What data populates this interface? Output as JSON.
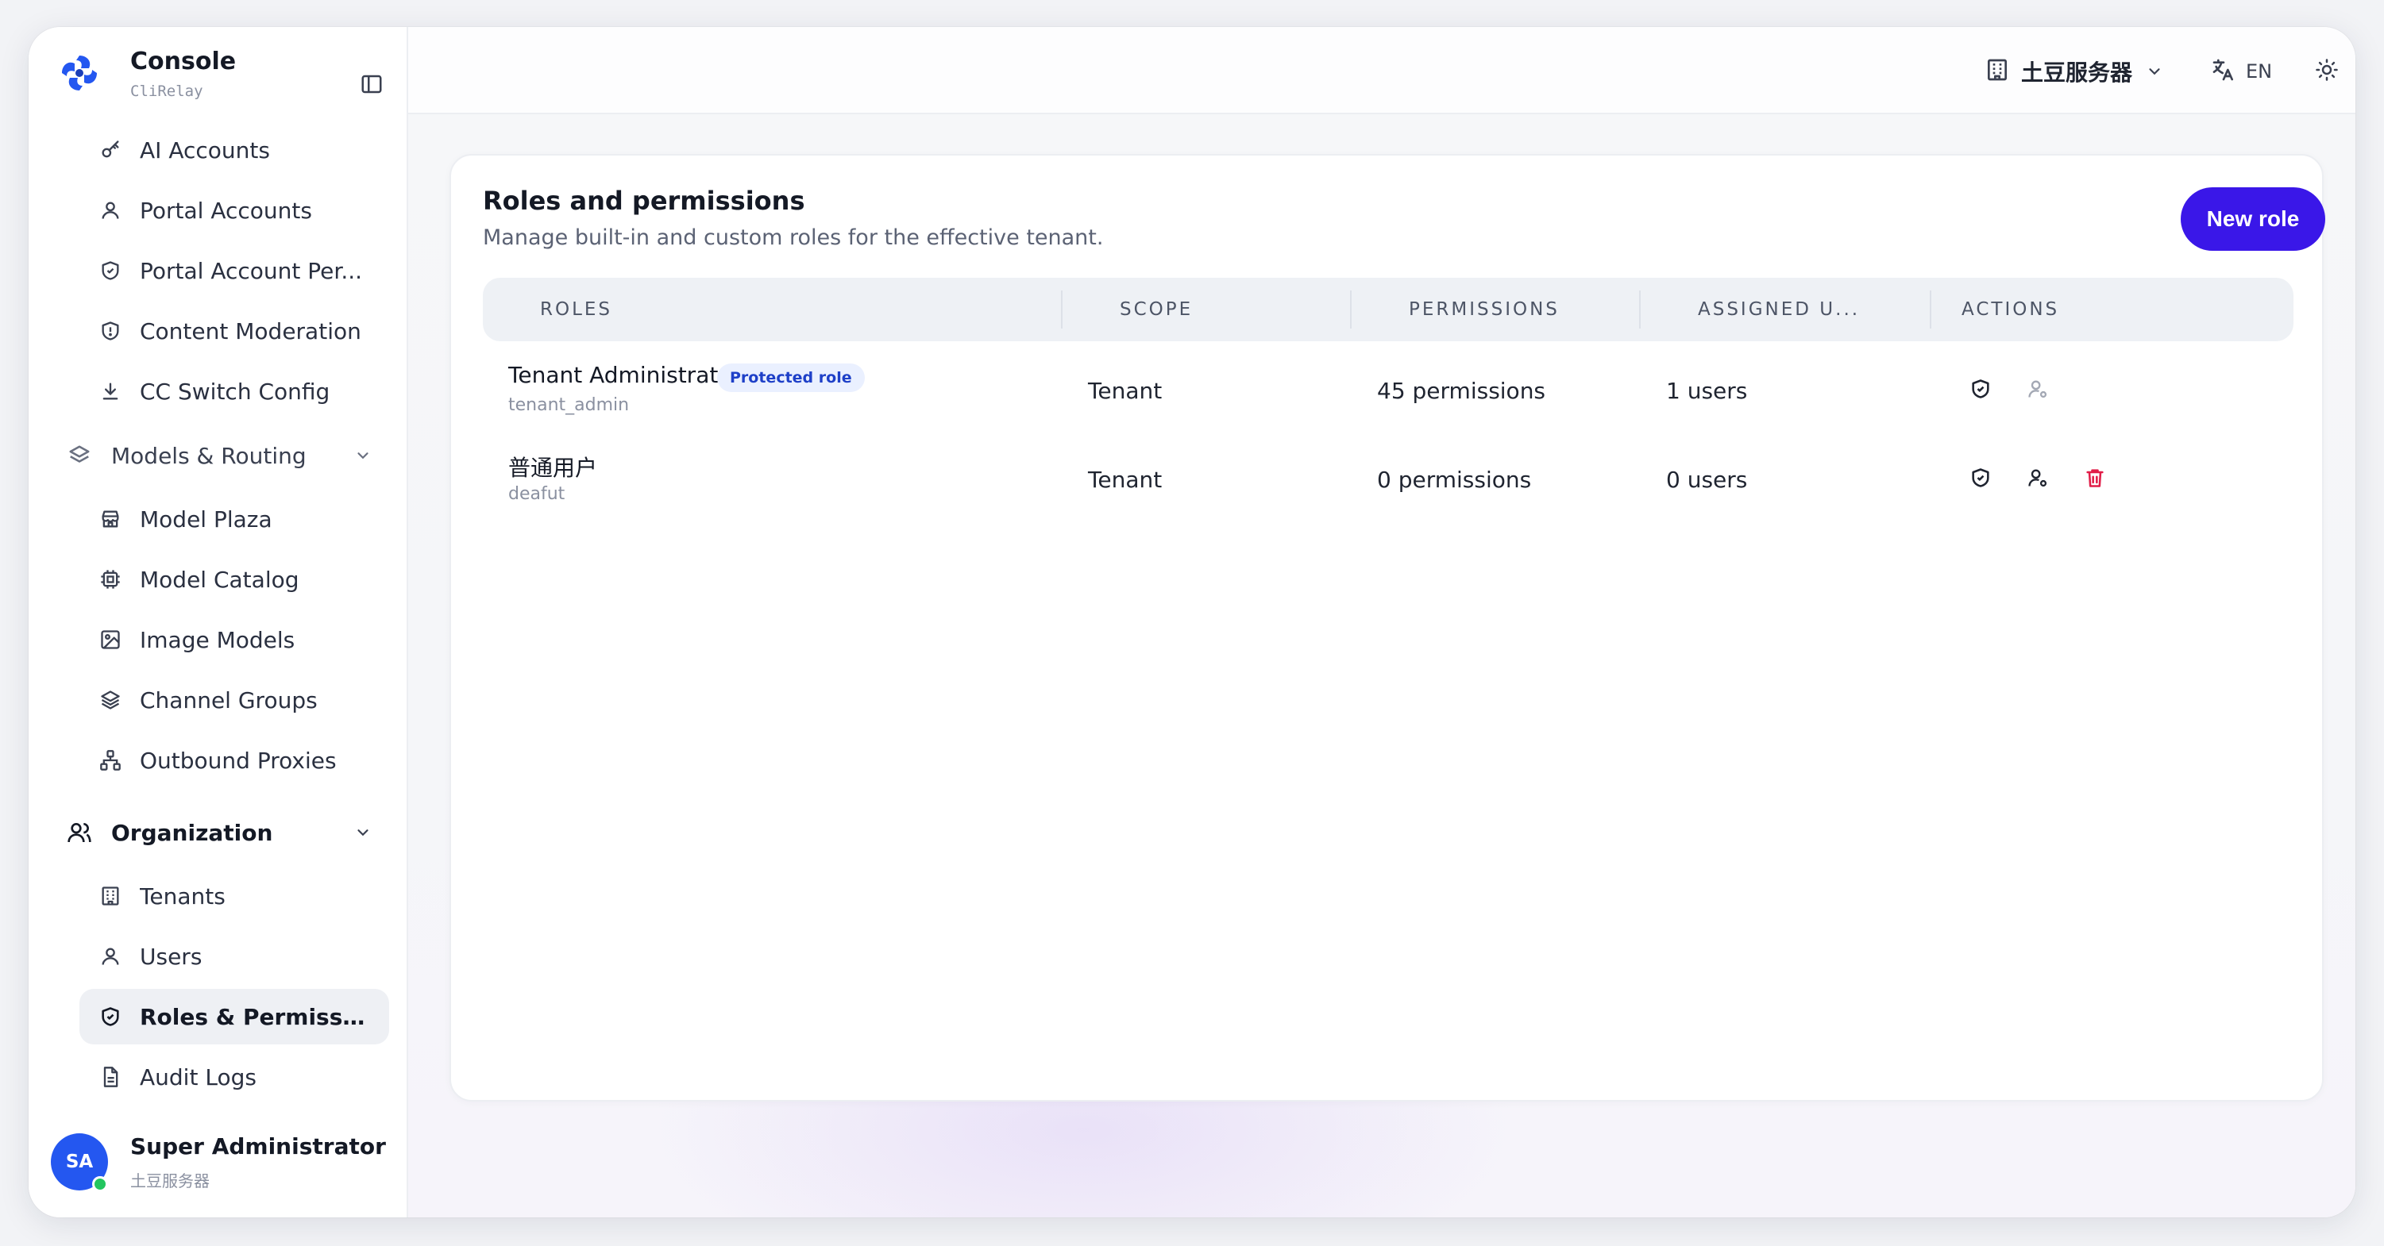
{
  "brand": {
    "title": "Console",
    "subtitle": "CliRelay"
  },
  "sidebar": {
    "items": [
      {
        "label": "AI Accounts",
        "icon": "key-icon"
      },
      {
        "label": "Portal Accounts",
        "icon": "user-icon"
      },
      {
        "label": "Portal Account Per...",
        "icon": "shield-check-icon"
      },
      {
        "label": "Content Moderation",
        "icon": "shield-alert-icon"
      },
      {
        "label": "CC Switch Config",
        "icon": "download-icon"
      }
    ],
    "group_models": {
      "label": "Models & Routing",
      "icon": "layers-icon"
    },
    "models_items": [
      {
        "label": "Model Plaza",
        "icon": "store-icon"
      },
      {
        "label": "Model Catalog",
        "icon": "cpu-icon"
      },
      {
        "label": "Image Models",
        "icon": "image-icon"
      },
      {
        "label": "Channel Groups",
        "icon": "layers-icon"
      },
      {
        "label": "Outbound Proxies",
        "icon": "network-icon"
      }
    ],
    "group_org": {
      "label": "Organization",
      "icon": "users-icon"
    },
    "org_items": [
      {
        "label": "Tenants",
        "icon": "building-icon"
      },
      {
        "label": "Users",
        "icon": "user-icon"
      },
      {
        "label": "Roles & Permissions",
        "icon": "shield-check-icon",
        "active": true
      },
      {
        "label": "Audit Logs",
        "icon": "file-text-icon"
      }
    ]
  },
  "user": {
    "initials": "SA",
    "name": "Super Administrator",
    "tenant": "土豆服务器"
  },
  "topbar": {
    "tenant": "土豆服务器",
    "language": "EN"
  },
  "page": {
    "title": "Roles and permissions",
    "subtitle": "Manage built-in and custom roles for the effective tenant.",
    "new_role_label": "New role"
  },
  "table": {
    "headers": [
      "ROLES",
      "SCOPE",
      "PERMISSIONS",
      "ASSIGNED U...",
      "ACTIONS"
    ],
    "rows": [
      {
        "name": "Tenant Administrator",
        "key": "tenant_admin",
        "badge": "Protected role",
        "scope": "Tenant",
        "permissions": "45 permissions",
        "users": "1 users"
      },
      {
        "name": "普通用户",
        "key": "deafut",
        "scope": "Tenant",
        "permissions": "0 permissions",
        "users": "0 users"
      }
    ]
  },
  "colors": {
    "accent": "#3a17e8",
    "brand_logo": "#2457f0",
    "danger": "#e11d48",
    "online": "#22c55e"
  }
}
